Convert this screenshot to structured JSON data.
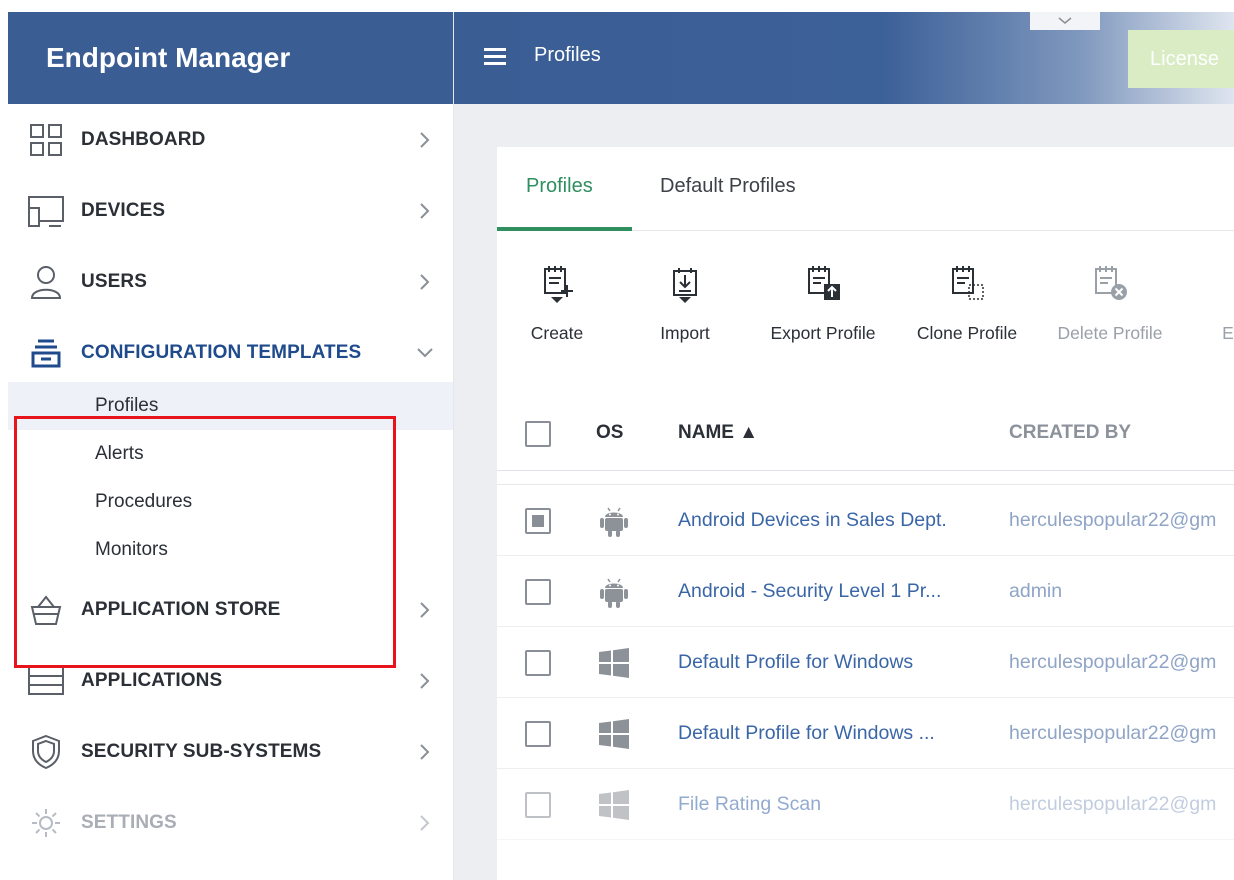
{
  "app": {
    "title": "Endpoint Manager"
  },
  "header": {
    "title": "Profiles",
    "license_label": "License"
  },
  "sidebar": {
    "items": [
      {
        "label": "DASHBOARD",
        "icon": "dashboard-icon"
      },
      {
        "label": "DEVICES",
        "icon": "devices-icon"
      },
      {
        "label": "USERS",
        "icon": "user-icon"
      },
      {
        "label": "CONFIGURATION TEMPLATES",
        "icon": "configuration-templates-icon",
        "expanded": true
      },
      {
        "label": "APPLICATION STORE",
        "icon": "application-store-icon"
      },
      {
        "label": "APPLICATIONS",
        "icon": "applications-icon"
      },
      {
        "label": "SECURITY SUB-SYSTEMS",
        "icon": "shield-icon"
      },
      {
        "label": "SETTINGS",
        "icon": "gear-icon",
        "disabled": true
      }
    ],
    "subitems": [
      {
        "label": "Profiles",
        "selected": true
      },
      {
        "label": "Alerts"
      },
      {
        "label": "Procedures"
      },
      {
        "label": "Monitors"
      }
    ]
  },
  "tabs": [
    {
      "label": "Profiles",
      "active": true
    },
    {
      "label": "Default Profiles"
    }
  ],
  "toolbar": [
    {
      "label": "Create",
      "icon": "create-profile-icon"
    },
    {
      "label": "Import",
      "icon": "import-profile-icon"
    },
    {
      "label": "Export Profile",
      "icon": "export-profile-icon"
    },
    {
      "label": "Clone Profile",
      "icon": "clone-profile-icon"
    },
    {
      "label": "Delete Profile",
      "icon": "delete-profile-icon",
      "disabled": true
    },
    {
      "label": "E",
      "icon": "more-icon",
      "disabled": true
    }
  ],
  "table": {
    "columns": [
      "OS",
      "NAME ▲",
      "CREATED BY"
    ],
    "rows": [
      {
        "os": "android",
        "name": "Android Devices in Sales Dept.",
        "created_by": "herculespopular22@gm",
        "checked": true
      },
      {
        "os": "android",
        "name": "Android - Security Level 1 Pr...",
        "created_by": "admin",
        "checked": false
      },
      {
        "os": "windows",
        "name": "Default Profile for Windows",
        "created_by": "herculespopular22@gm",
        "checked": false
      },
      {
        "os": "windows",
        "name": "Default Profile for Windows ...",
        "created_by": "herculespopular22@gm",
        "checked": false
      },
      {
        "os": "windows",
        "name": "File Rating Scan",
        "created_by": "herculespopular22@gm",
        "checked": false
      }
    ]
  },
  "colors": {
    "brand": "#3a5d94",
    "accent_tab": "#2f8f5f",
    "link": "#3a66a8",
    "highlight_box": "#e8141b"
  }
}
